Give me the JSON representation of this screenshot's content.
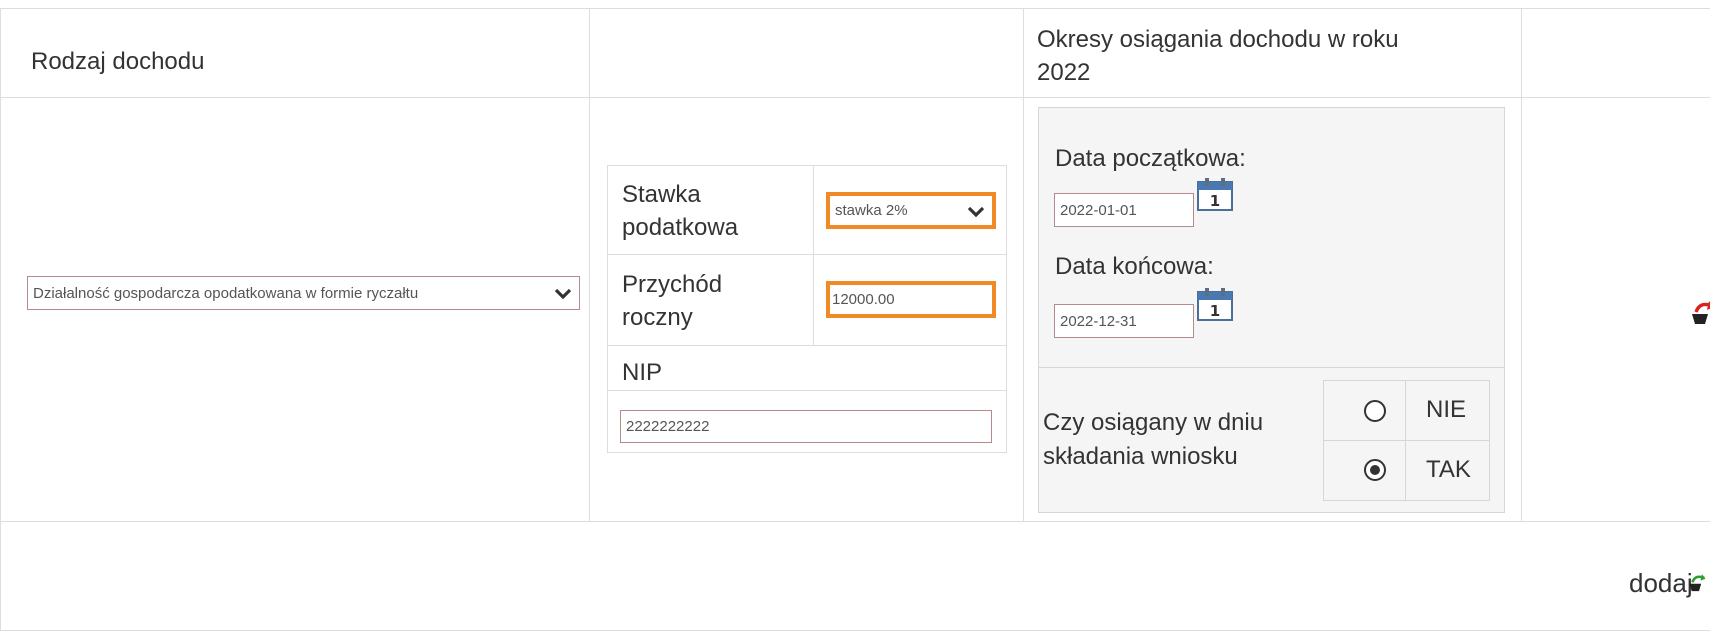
{
  "header": {
    "income_type": "Rodzaj dochodu",
    "periods_title_line1": "Okresy osiągania dochodu w roku",
    "periods_title_line2": "2022"
  },
  "row": {
    "income_type_value": "Działalność gospodarcza opodatkowana w formie ryczałtu",
    "tax_rate_label_line1": "Stawka",
    "tax_rate_label_line2": "podatkowa",
    "tax_rate_value": "stawka 2%",
    "revenue_label_line1": "Przychód",
    "revenue_label_line2": "roczny",
    "revenue_value": "12000.00",
    "nip_label": "NIP",
    "nip_value": "2222222222",
    "start_date_label": "Data początkowa:",
    "start_date_value": "2022-01-01",
    "end_date_label": "Data końcowa:",
    "end_date_value": "2022-12-31",
    "calendar_day": "1",
    "achieved_label_line1": "Czy osiągany w dniu",
    "achieved_label_line2": "składania wniosku",
    "option_no": "NIE",
    "option_yes": "TAK",
    "selected_option": "TAK"
  },
  "footer": {
    "add_label": "dodaj"
  },
  "icons": {
    "remove": "remove-row-icon",
    "add": "add-row-icon",
    "calendar": "calendar-icon",
    "dropdown": "chevron-down-icon"
  },
  "colors": {
    "highlight": "#f08a24",
    "field_border": "#b58a8a",
    "panel_bg": "#f5f5f5",
    "add_arrow": "#2e9e2e",
    "remove_arrow": "#d9231d"
  }
}
